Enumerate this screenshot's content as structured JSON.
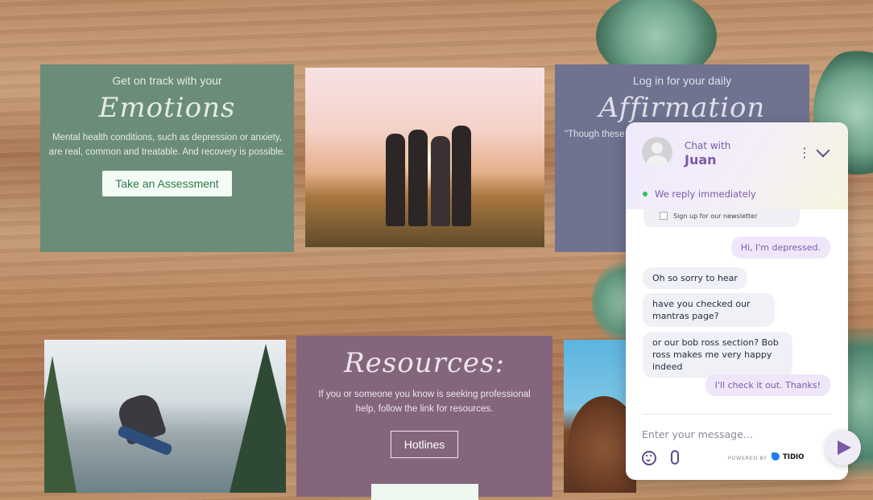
{
  "emotions_card": {
    "kicker": "Get on track with your",
    "title": "Emotions",
    "body": "Mental health conditions, such as depression or anxiety, are real, common and treatable. And recovery is possible.",
    "button": "Take an Assessment"
  },
  "affirmation_card": {
    "kicker": "Log in for your daily",
    "title": "Affirmation",
    "quote_fragment": "\"Though these"
  },
  "resources_card": {
    "title": "Resources:",
    "body": "If you or someone you know is seeking professional help, follow the link for resources.",
    "button": "Hotlines"
  },
  "chat": {
    "chat_with": "Chat with",
    "agent_name": "Juan",
    "status": "We reply immediately",
    "newsletter": "Sign up for our newsletter",
    "messages": [
      {
        "from": "user",
        "text": "Hi, I'm depressed."
      },
      {
        "from": "agent",
        "text": "Oh so sorry to hear"
      },
      {
        "from": "agent",
        "text": "have you checked our mantras page?"
      },
      {
        "from": "agent",
        "text": "or our bob ross section? Bob ross makes me very happy indeed"
      },
      {
        "from": "user",
        "text": "I'll check it out. Thanks!"
      }
    ],
    "input_placeholder": "Enter your message...",
    "powered_by": "POWERED BY",
    "brand": "TIDIO"
  },
  "icons": [
    "avatar-icon",
    "kebab-menu-icon",
    "chevron-down-icon",
    "emoji-icon",
    "paperclip-icon",
    "tidio-logo-icon",
    "send-icon"
  ]
}
